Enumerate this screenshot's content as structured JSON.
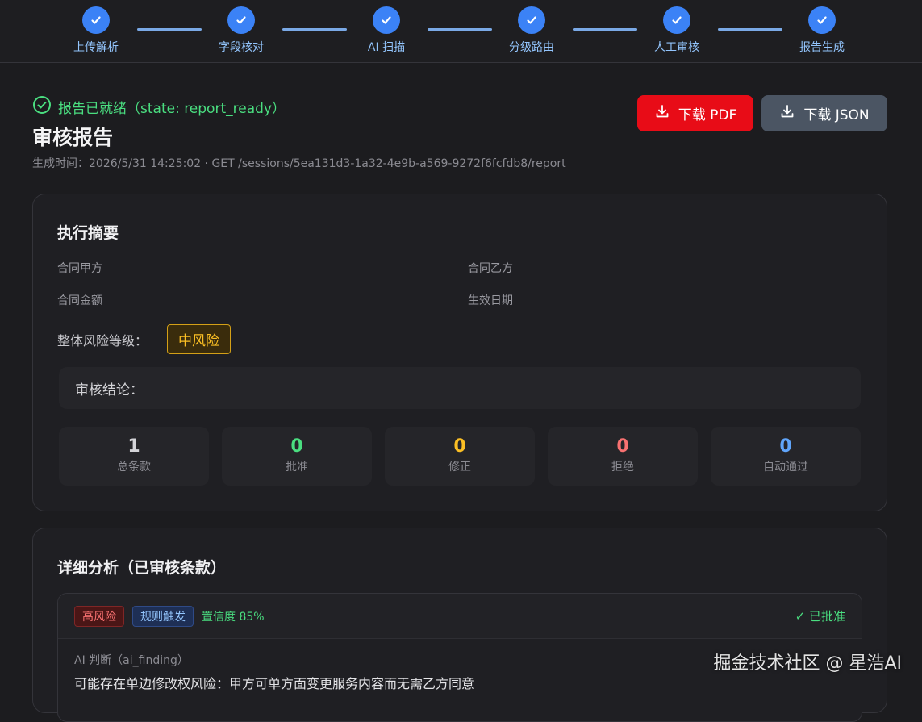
{
  "stepper": {
    "steps": [
      {
        "label": "上传解析"
      },
      {
        "label": "字段核对"
      },
      {
        "label": "AI 扫描"
      },
      {
        "label": "分级路由"
      },
      {
        "label": "人工审核"
      },
      {
        "label": "报告生成"
      }
    ],
    "accent": "#3b82f6"
  },
  "header": {
    "status": "报告已就绪（state: report_ready）",
    "title": "审核报告",
    "meta": "生成时间：2026/5/31 14:25:02 · GET /sessions/5ea131d3-1a32-4e9b-a569-9272f6fcfdb8/report",
    "download_pdf": "下载 PDF",
    "download_json": "下载 JSON"
  },
  "summary": {
    "title": "执行摘要",
    "party_a_label": "合同甲方",
    "party_b_label": "合同乙方",
    "amount_label": "合同金额",
    "effective_date_label": "生效日期",
    "risk_label": "整体风险等级：",
    "risk_value": "中风险",
    "conclusion_label": "审核结论：",
    "stats": [
      {
        "value": "1",
        "label": "总条款",
        "color": "#d4d4d8"
      },
      {
        "value": "0",
        "label": "批准",
        "color": "#4ade80"
      },
      {
        "value": "0",
        "label": "修正",
        "color": "#fbbf24"
      },
      {
        "value": "0",
        "label": "拒绝",
        "color": "#f87171"
      },
      {
        "value": "0",
        "label": "自动通过",
        "color": "#60a5fa"
      }
    ]
  },
  "detail": {
    "title": "详细分析（已审核条款）",
    "finding": {
      "risk_tag": "高风险",
      "source_tag": "规则触发",
      "confidence": "置信度 85%",
      "status": "✓ 已批准",
      "sub_label": "AI 判断（ai_finding）",
      "description": "可能存在单边修改权风险：甲方可单方面变更服务内容而无需乙方同意"
    }
  },
  "watermark": "掘金技术社区 @ 星浩AI"
}
